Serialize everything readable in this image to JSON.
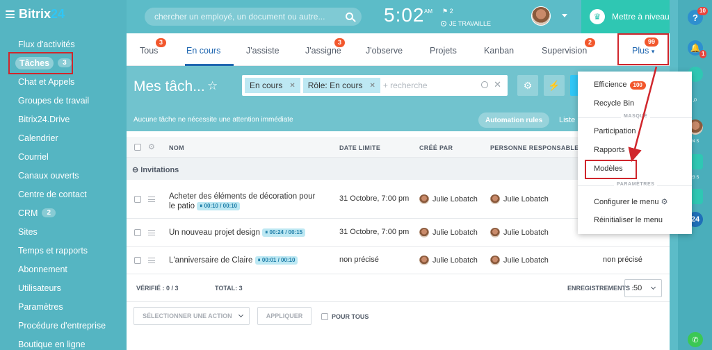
{
  "brand": {
    "name_main": "Bitrix",
    "name_accent": "24"
  },
  "sidebar": {
    "items": [
      {
        "label": "Flux d'activités"
      },
      {
        "label": "Tâches",
        "count": "3",
        "active": true
      },
      {
        "label": "Chat et Appels"
      },
      {
        "label": "Groupes de travail"
      },
      {
        "label": "Bitrix24.Drive"
      },
      {
        "label": "Calendrier"
      },
      {
        "label": "Courriel"
      },
      {
        "label": "Canaux ouverts"
      },
      {
        "label": "Centre de contact"
      },
      {
        "label": "CRM",
        "count": "2"
      },
      {
        "label": "Sites"
      },
      {
        "label": "Temps et rapports"
      },
      {
        "label": "Abonnement"
      },
      {
        "label": "Utilisateurs"
      },
      {
        "label": "Paramètres"
      },
      {
        "label": "Procédure d'entreprise"
      },
      {
        "label": "Boutique en ligne"
      }
    ]
  },
  "topbar": {
    "search_placeholder": "chercher un employé, un document ou autre...",
    "time": "5:02",
    "ampm": "AM",
    "flag_count": "2",
    "work_status": "JE TRAVAILLE",
    "upgrade_label": "Mettre à niveau"
  },
  "right_bar": {
    "help_badge": "10",
    "bell_badge": "1",
    "label_24": "24",
    "text_s1": "24 S",
    "text_s2": "23 S"
  },
  "tabs": [
    {
      "label": "Tous",
      "badge": "3"
    },
    {
      "label": "En cours",
      "active": true
    },
    {
      "label": "J'assiste"
    },
    {
      "label": "J'assigne",
      "badge": "3"
    },
    {
      "label": "J'observe"
    },
    {
      "label": "Projets"
    },
    {
      "label": "Kanban"
    },
    {
      "label": "Supervision",
      "badge": "2"
    },
    {
      "label": "Plus",
      "badge": "99"
    }
  ],
  "page": {
    "title": "Mes tâch...",
    "filter_chips": [
      "En cours",
      "Rôle: En cours"
    ],
    "filter_placeholder": "+ recherche",
    "attention_text": "Aucune tâche ne nécessite une attention immédiate",
    "automation_label": "Automation rules",
    "view_label": "Liste"
  },
  "table": {
    "headers": {
      "name": "NOM",
      "deadline": "DATE LIMITE",
      "created_by": "CRÉÉ PAR",
      "responsible": "PERSONNE RESPONSABLE"
    },
    "group_label": "Invitations",
    "rows": [
      {
        "name": "Acheter des éléments de décoration pour le patio",
        "timer": "00:10 / 00:10",
        "deadline": "31 Octobre, 7:00 pm",
        "created_by": "Julie Lobatch",
        "responsible": "Julie Lobatch",
        "extra": ""
      },
      {
        "name": "Un nouveau projet design",
        "timer": "00:24 / 00:15",
        "deadline": "31 Octobre, 7:00 pm",
        "created_by": "Julie Lobatch",
        "responsible": "Julie Lobatch",
        "extra": ""
      },
      {
        "name": "L'anniversaire de Claire",
        "timer": "00:01 / 00:10",
        "deadline": "non précisé",
        "created_by": "Julie Lobatch",
        "responsible": "Julie Lobatch",
        "extra": "non précisé"
      }
    ]
  },
  "footer": {
    "verified": "VÉRIFIÉ : 0 / 3",
    "total": "TOTAL: 3",
    "records_label": "ENREGISTREMENTS :",
    "records_value": "50",
    "action_placeholder": "SÉLECTIONNER UNE ACTION",
    "apply_label": "APPLIQUER",
    "for_all_label": "POUR TOUS"
  },
  "popup": {
    "efficiency_label": "Efficience",
    "efficiency_badge": "100",
    "recycle_label": "Recycle Bin",
    "section_hidden": "MASQUÉ",
    "participation_label": "Participation",
    "reports_label": "Rapports",
    "templates_label": "Modèles",
    "section_settings": "PARAMÈTRES",
    "configure_label": "Configurer le menu",
    "reset_label": "Réinitialiser le menu"
  },
  "colors": {
    "accent_blue": "#2067b0",
    "badge_orange": "#f2572c",
    "highlight_red": "#d0262c",
    "upgrade_teal": "#2fc7b3"
  }
}
